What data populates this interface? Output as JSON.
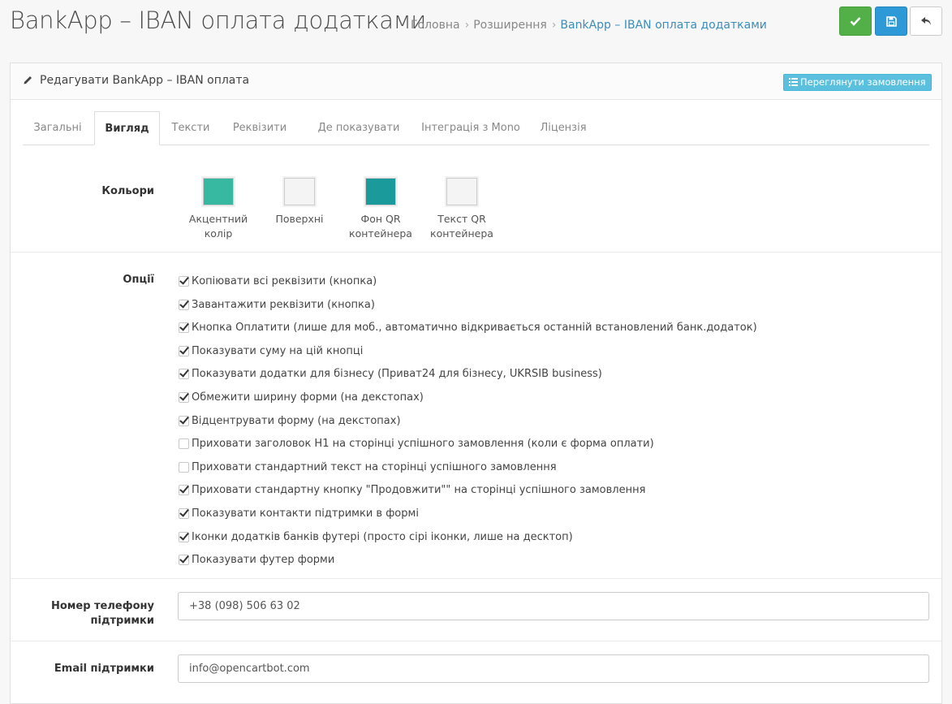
{
  "header": {
    "title": "BankApp – IBAN оплата додатками",
    "breadcrumb": [
      "Головна",
      "Розширення",
      "BankApp – IBAN оплата додатками"
    ]
  },
  "panel": {
    "title": "Редагувати BankApp – IBAN оплата",
    "view_orders_label": "Переглянути замовлення"
  },
  "tabs": [
    "Загальні",
    "Вигляд",
    "Тексти",
    "Реквізити",
    "Де показувати",
    "Інтеграція з Mono",
    "Ліцензія"
  ],
  "active_tab": "Вигляд",
  "colors_section": {
    "label": "Кольори",
    "swatches": [
      {
        "label_line1": "Акцентний",
        "label_line2": "колір",
        "color": "#36b9a0"
      },
      {
        "label_line1": "Поверхні",
        "label_line2": "",
        "color": "#f4f4f4"
      },
      {
        "label_line1": "Фон QR",
        "label_line2": "контейнера",
        "color": "#1a9a9a"
      },
      {
        "label_line1": "Текст QR",
        "label_line2": "контейнера",
        "color": "#f4f4f4"
      }
    ]
  },
  "options_section": {
    "label": "Опції",
    "items": [
      {
        "text": "Копіювати всі реквізити (кнопка)",
        "checked": true
      },
      {
        "text": "Завантажити реквізити (кнопка)",
        "checked": true
      },
      {
        "text": "Кнопка Оплатити (лише для моб., автоматично відкривається останній встановлений банк.додаток)",
        "checked": true
      },
      {
        "text": "Показувати суму на цій кнопці",
        "checked": true
      },
      {
        "text": "Показувати додатки для бізнесу (Приват24 для бізнесу, UKRSIB business)",
        "checked": true
      },
      {
        "text": "Обмежити ширину форми (на декстопах)",
        "checked": true
      },
      {
        "text": "Відцентрувати форму (на декстопах)",
        "checked": true
      },
      {
        "text": "Приховати заголовок H1 на сторінці успішного замовлення (коли є форма оплати)",
        "checked": false
      },
      {
        "text": "Приховати стандартний текст на сторінці успішного замовлення",
        "checked": false
      },
      {
        "text": "Приховати стандартну кнопку \"Продовжити\"\" на сторінці успішного замовлення",
        "checked": true
      },
      {
        "text": "Показувати контакти підтримки в формі",
        "checked": true
      },
      {
        "text": "Іконки додатків банків футері (просто сірі іконки, лише на десктоп)",
        "checked": true
      },
      {
        "text": "Показувати футер форми",
        "checked": true
      }
    ]
  },
  "phone_field": {
    "label_line1": "Номер телефону",
    "label_line2": "підтримки",
    "value": "+38 (098) 506 63 02"
  },
  "email_field": {
    "label": "Email підтримки",
    "value": "info@opencartbot.com"
  },
  "accent_colors": {
    "save": "#53b048",
    "apply": "#2e99d7",
    "info": "#5bc0de",
    "link": "#3c8dbc"
  }
}
